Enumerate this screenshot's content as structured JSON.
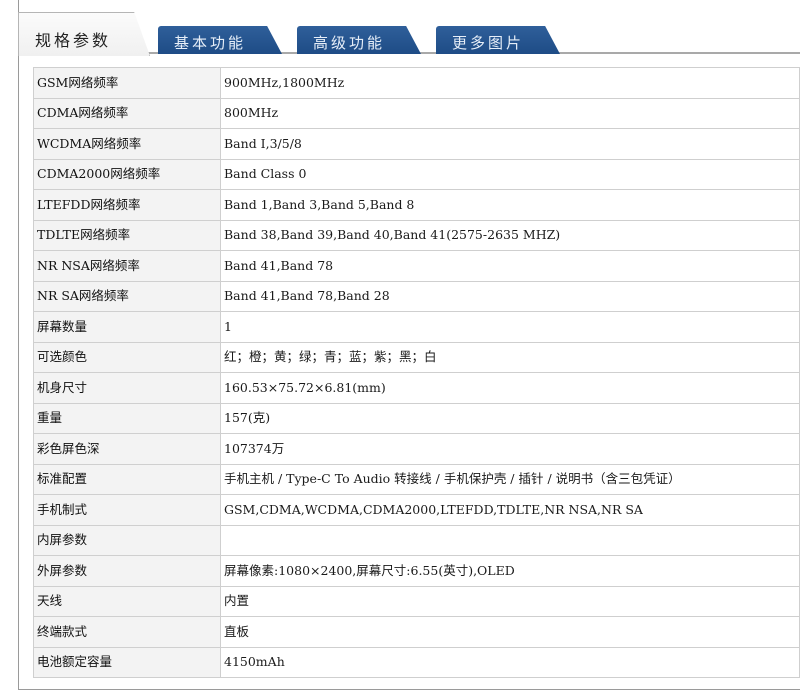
{
  "tabs": [
    {
      "label": "规格参数",
      "active": true
    },
    {
      "label": "基本功能",
      "active": false
    },
    {
      "label": "高级功能",
      "active": false
    },
    {
      "label": "更多图片",
      "active": false
    }
  ],
  "colors": {
    "tab_active_bg": "#f3f3f3",
    "tab_inactive_bg": "#2a5890",
    "label_cell_bg": "#f3f3f3",
    "border": "#cfcfcf"
  },
  "specs": [
    {
      "label": "GSM网络频率",
      "value": "900MHz,1800MHz"
    },
    {
      "label": "CDMA网络频率",
      "value": "800MHz"
    },
    {
      "label": "WCDMA网络频率",
      "value": "Band Ⅰ,3/5/8"
    },
    {
      "label": "CDMA2000网络频率",
      "value": "Band Class 0"
    },
    {
      "label": "LTEFDD网络频率",
      "value": "Band 1,Band 3,Band 5,Band 8"
    },
    {
      "label": "TDLTE网络频率",
      "value": "Band 38,Band 39,Band 40,Band 41(2575-2635 MHZ)"
    },
    {
      "label": "NR NSA网络频率",
      "value": "Band 41,Band 78"
    },
    {
      "label": "NR SA网络频率",
      "value": "Band 41,Band 78,Band 28"
    },
    {
      "label": "屏幕数量",
      "value": "1"
    },
    {
      "label": "可选颜色",
      "value": "红；橙；黄；绿；青；蓝；紫；黑；白"
    },
    {
      "label": "机身尺寸",
      "value": "160.53×75.72×6.81(mm)"
    },
    {
      "label": "重量",
      "value": "157(克)"
    },
    {
      "label": "彩色屏色深",
      "value": "107374万"
    },
    {
      "label": "标准配置",
      "value": "手机主机 / Type-C To Audio 转接线 / 手机保护壳 / 插针 / 说明书（含三包凭证）"
    },
    {
      "label": "手机制式",
      "value": "GSM,CDMA,WCDMA,CDMA2000,LTEFDD,TDLTE,NR NSA,NR SA"
    },
    {
      "label": "内屏参数",
      "value": ""
    },
    {
      "label": "外屏参数",
      "value": "屏幕像素:1080×2400,屏幕尺寸:6.55(英寸),OLED"
    },
    {
      "label": "天线",
      "value": "内置"
    },
    {
      "label": "终端款式",
      "value": "直板"
    },
    {
      "label": "电池额定容量",
      "value": "4150mAh"
    }
  ]
}
